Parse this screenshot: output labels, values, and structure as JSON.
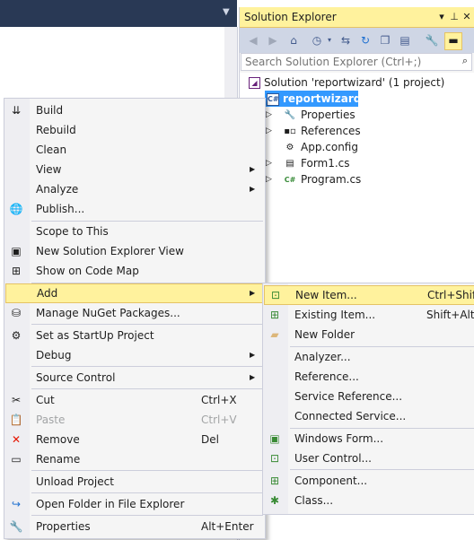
{
  "solution_explorer": {
    "title": "Solution Explorer",
    "title_buttons": [
      "pin-dropdown-icon",
      "pin-icon",
      "close-icon"
    ],
    "toolbar_icons": [
      "back-icon",
      "forward-icon",
      "home-icon",
      "history-icon",
      "sync-icon",
      "refresh-icon",
      "collapse-all-icon",
      "show-all-files-icon",
      "properties-wrench-icon",
      "preview-icon"
    ],
    "search_placeholder": "Search Solution Explorer (Ctrl+;)",
    "tree": {
      "solution": "Solution 'reportwizard' (1 project)",
      "project": "reportwizard",
      "items": [
        "Properties",
        "References",
        "App.config",
        "Form1.cs",
        "Program.cs"
      ]
    }
  },
  "context_menu": {
    "items": [
      {
        "label": "Build",
        "icon": "build-icon",
        "shortcut": ""
      },
      {
        "label": "Rebuild",
        "icon": "",
        "shortcut": ""
      },
      {
        "label": "Clean",
        "icon": "",
        "shortcut": ""
      },
      {
        "label": "View",
        "icon": "",
        "shortcut": ""
      },
      {
        "label": "Analyze",
        "icon": "",
        "shortcut": ""
      },
      {
        "label": "Publish...",
        "icon": "publish-globe-icon",
        "shortcut": ""
      },
      {
        "label": "Scope to This",
        "icon": "",
        "shortcut": ""
      },
      {
        "label": "New Solution Explorer View",
        "icon": "new-view-icon",
        "shortcut": ""
      },
      {
        "label": "Show on Code Map",
        "icon": "code-map-icon",
        "shortcut": ""
      },
      {
        "label": "Add",
        "icon": "",
        "shortcut": ""
      },
      {
        "label": "Manage NuGet Packages...",
        "icon": "nuget-icon",
        "shortcut": ""
      },
      {
        "label": "Set as StartUp Project",
        "icon": "gear-icon",
        "shortcut": ""
      },
      {
        "label": "Debug",
        "icon": "",
        "shortcut": ""
      },
      {
        "label": "Source Control",
        "icon": "",
        "shortcut": ""
      },
      {
        "label": "Cut",
        "icon": "scissors-icon",
        "shortcut": "Ctrl+X"
      },
      {
        "label": "Paste",
        "icon": "paste-icon",
        "shortcut": "Ctrl+V"
      },
      {
        "label": "Remove",
        "icon": "remove-x-icon",
        "shortcut": "Del"
      },
      {
        "label": "Rename",
        "icon": "rename-icon",
        "shortcut": ""
      },
      {
        "label": "Unload Project",
        "icon": "",
        "shortcut": ""
      },
      {
        "label": "Open Folder in File Explorer",
        "icon": "open-folder-icon",
        "shortcut": ""
      },
      {
        "label": "Properties",
        "icon": "wrench-icon",
        "shortcut": "Alt+Enter"
      }
    ]
  },
  "add_submenu": {
    "items": [
      {
        "label": "New Item...",
        "icon": "new-item-icon",
        "shortcut": "Ctrl+Shift+A"
      },
      {
        "label": "Existing Item...",
        "icon": "existing-item-icon",
        "shortcut": "Shift+Alt+A"
      },
      {
        "label": "New Folder",
        "icon": "new-folder-icon",
        "shortcut": ""
      },
      {
        "label": "Analyzer...",
        "icon": "",
        "shortcut": ""
      },
      {
        "label": "Reference...",
        "icon": "",
        "shortcut": ""
      },
      {
        "label": "Service Reference...",
        "icon": "",
        "shortcut": ""
      },
      {
        "label": "Connected Service...",
        "icon": "",
        "shortcut": ""
      },
      {
        "label": "Windows Form...",
        "icon": "windows-form-icon",
        "shortcut": ""
      },
      {
        "label": "User Control...",
        "icon": "user-control-icon",
        "shortcut": ""
      },
      {
        "label": "Component...",
        "icon": "component-icon",
        "shortcut": ""
      },
      {
        "label": "Class...",
        "icon": "class-icon",
        "shortcut": ""
      }
    ]
  },
  "colors": {
    "highlight": "#fff29d",
    "selection": "#3399ff",
    "menu_bg": "#f5f5f5",
    "toolbar_bg": "#cfd6e5",
    "top_bar": "#293955"
  }
}
